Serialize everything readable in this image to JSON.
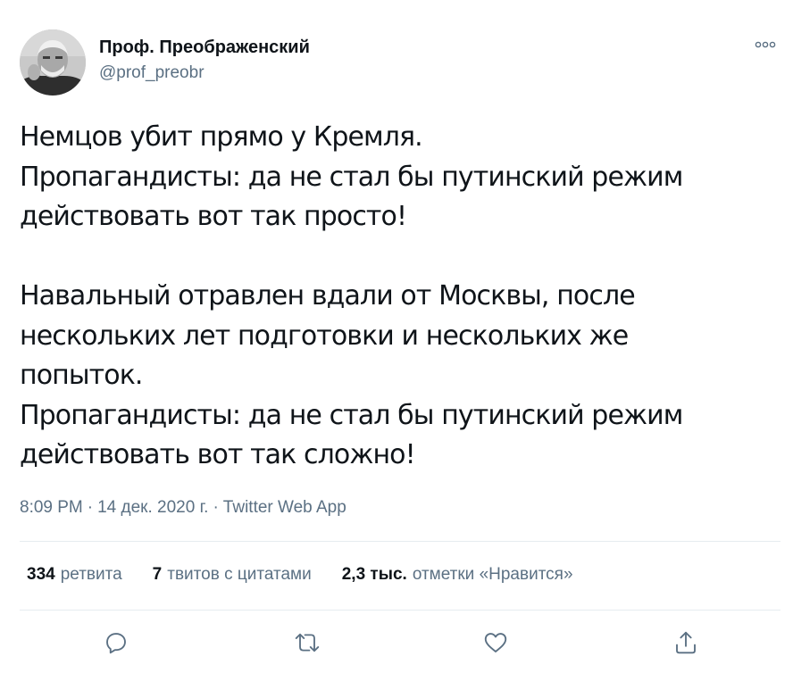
{
  "author": {
    "name": "Проф. Преображенский",
    "handle": "@prof_preobr"
  },
  "tweet": {
    "text": "Немцов убит прямо у Кремля.\nПропагандисты: да не стал бы путинский режим\nдействовать вот так просто!\n\nНавальный отравлен вдали от Москвы, после\nнескольких лет подготовки и нескольких же\nпопыток.\nПропагандисты: да не стал бы путинский режим\nдействовать вот так сложно!",
    "time": "8:09 PM",
    "date": "14 дек. 2020 г.",
    "separator": "·",
    "source": "Twitter Web App"
  },
  "stats": {
    "retweets_count": "334",
    "retweets_label": "ретвита",
    "quotes_count": "7",
    "quotes_label": "твитов с цитатами",
    "likes_count": "2,3 тыс.",
    "likes_label": "отметки «Нравится»"
  },
  "icons": {
    "more": "more-dots-icon",
    "reply": "reply-icon",
    "retweet": "retweet-icon",
    "like": "heart-icon",
    "share": "share-icon"
  },
  "colors": {
    "text": "#0f1419",
    "secondary": "#5b7083",
    "divider": "#e6ecf0"
  }
}
